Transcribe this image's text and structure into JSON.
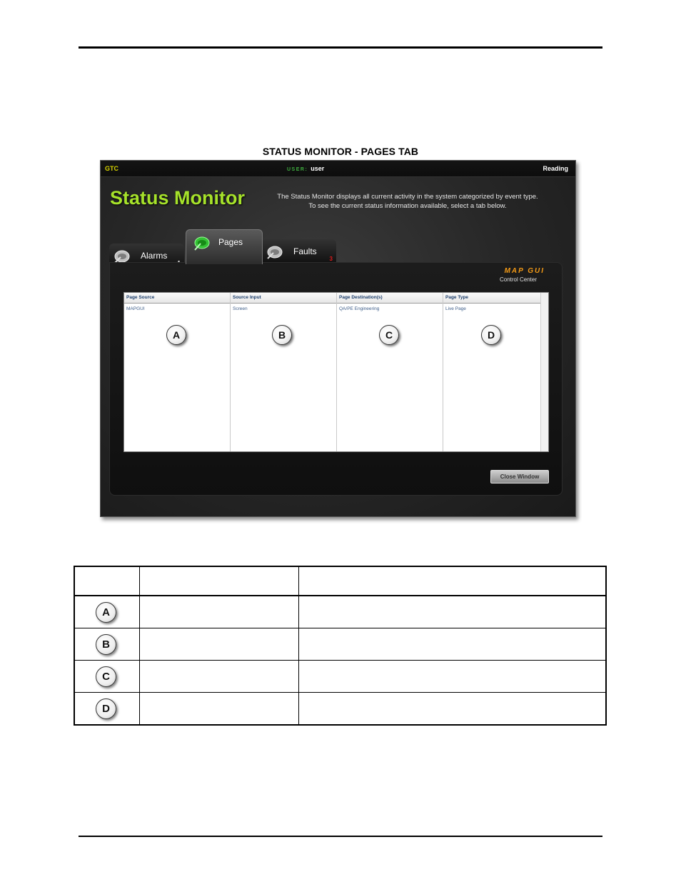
{
  "figure": {
    "title": "STATUS MONITOR - PAGES TAB"
  },
  "window": {
    "topbar": {
      "left": "GTC",
      "user_key": "USER:",
      "user_value": "user",
      "right": "Reading"
    },
    "title": "Status Monitor",
    "description_line1": "The Status Monitor displays all current activity in the system categorized by event type.",
    "description_line2": "To see the current status information available, select a tab below.",
    "tabs": [
      {
        "label": "Alarms",
        "count": "1",
        "icon": "satellite-dish-icon",
        "active": false
      },
      {
        "label": "Pages",
        "count": "",
        "icon": "satellite-dish-icon",
        "active": true
      },
      {
        "label": "Faults",
        "count": "3",
        "icon": "satellite-dish-icon",
        "active": false
      }
    ],
    "brand": {
      "name": "MAP GUI",
      "subtitle": "Control Center"
    },
    "grid": {
      "columns": [
        "Page Source",
        "Source Input",
        "Page Destination(s)",
        "Page Type"
      ],
      "rows": [
        [
          "MAPGUI",
          "Screen",
          "QA/PE Engineering",
          "Live Page"
        ]
      ],
      "callouts": [
        "A",
        "B",
        "C",
        "D"
      ]
    },
    "close_button": "Close Window"
  },
  "legend": {
    "rows": [
      {
        "callout": "A"
      },
      {
        "callout": "B"
      },
      {
        "callout": "C"
      },
      {
        "callout": "D"
      }
    ]
  },
  "colors": {
    "title_green": "#a6e22a",
    "brand_orange": "#f39a16",
    "faults_count_red": "#e21a1a"
  }
}
